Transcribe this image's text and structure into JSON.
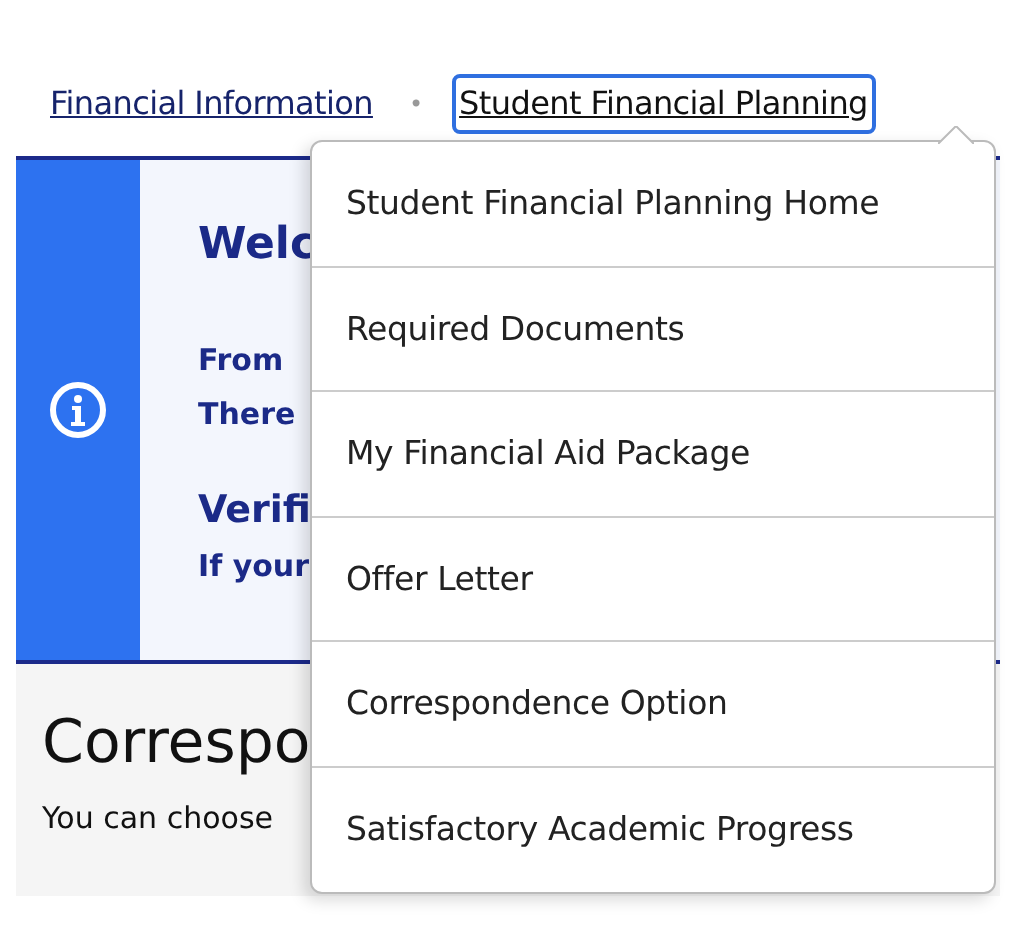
{
  "breadcrumb": [
    {
      "label": "Financial Information",
      "focused": false
    },
    {
      "label": "Student Financial Planning",
      "focused": true
    }
  ],
  "separator": "•",
  "alert": {
    "title": "Welc",
    "lines": [
      "From",
      "There"
    ],
    "subtitle": "Verifi",
    "note": "If your"
  },
  "section": {
    "heading": "Correspo",
    "text": "You can choose"
  },
  "menu": {
    "items": [
      "Student Financial Planning Home",
      "Required Documents",
      "My Financial Aid Package",
      "Offer Letter",
      "Correspondence Option",
      "Satisfactory Academic Progress"
    ]
  }
}
